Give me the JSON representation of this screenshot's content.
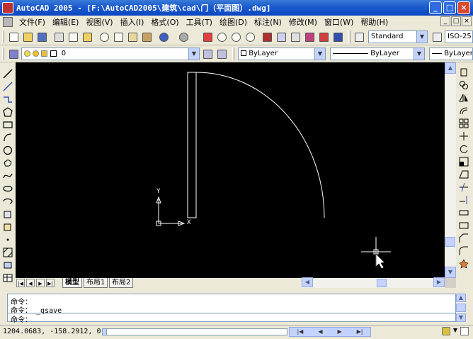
{
  "window": {
    "title": "AutoCAD 2005 - [F:\\AutoCAD2005\\建筑\\cad\\门（平面图）.dwg]",
    "minimize": "_",
    "maximize": "□",
    "close": "×"
  },
  "menu": {
    "items": [
      "文件(F)",
      "编辑(E)",
      "视图(V)",
      "插入(I)",
      "格式(O)",
      "工具(T)",
      "绘图(D)",
      "标注(N)",
      "修改(M)",
      "窗口(W)",
      "帮助(H)"
    ]
  },
  "toolbar": {
    "text_style": "Standard",
    "dim_style": "ISO-25",
    "layer_value": "0",
    "color_value": "ByLayer",
    "linetype_value": "ByLayer",
    "lineweight_value": "ByLayer"
  },
  "ucs": {
    "x_label": "X",
    "y_label": "Y"
  },
  "tabs": [
    "模型",
    "布局1",
    "布局2"
  ],
  "active_tab": "模型",
  "command": {
    "line1": "命令：",
    "line2": "命令： _qsave",
    "prompt": "命令："
  },
  "status": {
    "coordinates": "1204.0683, -158.2912, 0.0"
  },
  "colors": {
    "canvas": "#000000",
    "drawing": "#ffffff",
    "titlebar": "#0a46c2"
  },
  "icons": {
    "arrow_left": "◀",
    "arrow_right": "▶",
    "arrow_up": "▲",
    "arrow_down": "▼",
    "first": "|◀",
    "last": "▶|",
    "dropdown": "▼"
  }
}
